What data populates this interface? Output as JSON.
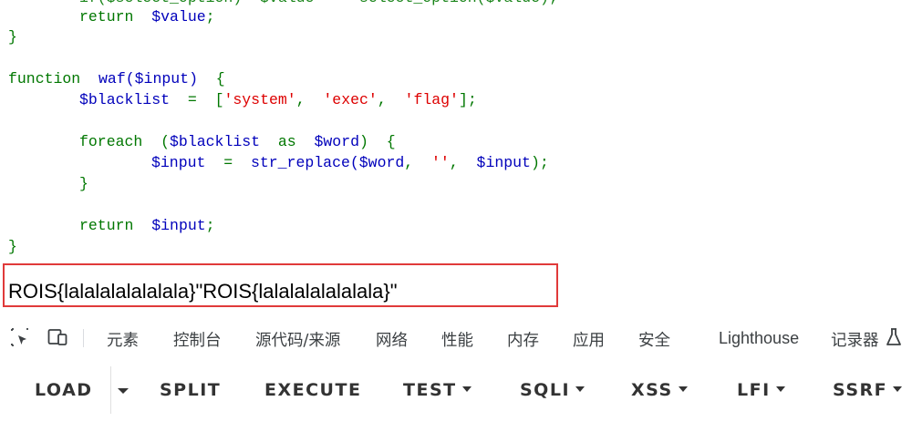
{
  "code": {
    "line0": {
      "a": "if($select_option) $value = select_option($value);"
    },
    "line1": {
      "kw": "return",
      "var": "$value",
      "end": ";"
    },
    "line2": {
      "brace": "}"
    },
    "line3": {
      "kw": "function",
      "name": "waf(",
      "var": "$input",
      "rest": ")",
      "brace": "{"
    },
    "line4": {
      "var": "$blacklist",
      "eq": "=",
      "open": "[",
      "s1": "'system'",
      "c1": ",",
      "s2": "'exec'",
      "c2": ",",
      "s3": "'flag'",
      "close": "];"
    },
    "line5": {
      "kw": "foreach",
      "open": "(",
      "var1": "$blacklist",
      "as": "as",
      "var2": "$word",
      "close": ")",
      "brace": "{"
    },
    "line6": {
      "var": "$input",
      "eq": "=",
      "fn": "str_replace(",
      "a1": "$word",
      "c1": ",",
      "s": "''",
      "c2": ",",
      "a2": "$input",
      "close": ");"
    },
    "line7": {
      "brace": "}"
    },
    "line8": {
      "kw": "return",
      "var": "$input",
      "end": ";"
    },
    "line9": {
      "brace": "}"
    }
  },
  "output": {
    "text": "ROIS{lalalalalalalala}\"ROIS{lalalalalalalala}\""
  },
  "devtools": {
    "tabs": [
      "元素",
      "控制台",
      "源代码/来源",
      "网络",
      "性能",
      "内存",
      "应用",
      "安全",
      "Lighthouse",
      "记录器"
    ]
  },
  "hackbar": {
    "load": "LOAD",
    "split": "SPLIT",
    "execute": "EXECUTE",
    "test": "TEST",
    "sqli": "SQLI",
    "xss": "XSS",
    "lfi": "LFI",
    "ssrf": "SSRF"
  },
  "colors": {
    "keyword": "#007700",
    "variable": "#0000BB",
    "string": "#DD0000",
    "highlight_border": "#e03a3a"
  }
}
